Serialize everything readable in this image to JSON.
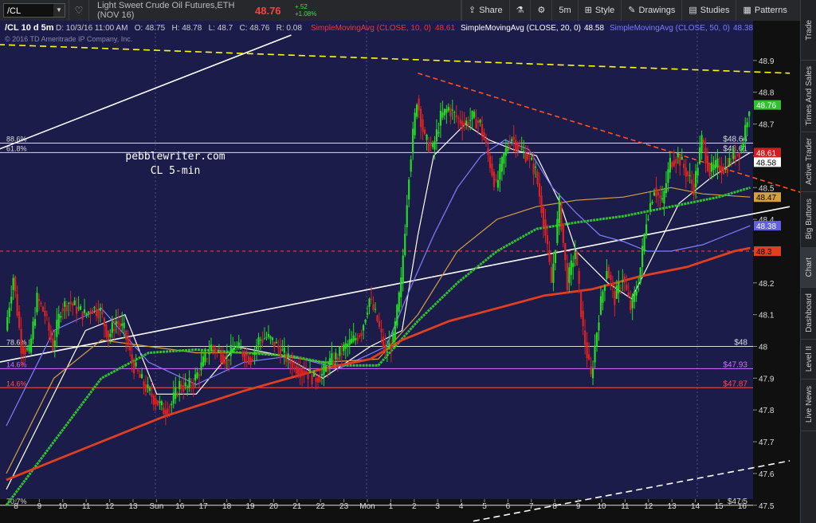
{
  "toolbar": {
    "symbol": "/CL",
    "instrument": "Light Sweet Crude Oil Futures,ETH (NOV 16)",
    "last": "48.76",
    "change": "+.52",
    "change_pct": "+1.08%",
    "buttons": [
      "Share",
      "5m",
      "Style",
      "Drawings",
      "Studies",
      "Patterns"
    ]
  },
  "sidebar": {
    "tabs": [
      "Trade",
      "Times And Sales",
      "Active Trader",
      "Big Buttons",
      "Chart",
      "Dashboard",
      "Level II",
      "Live News"
    ],
    "active": "Chart"
  },
  "legend": {
    "header": "/CL 10 d 5m",
    "ohlc": "D: 10/3/16 11:00 AM   O: 48.75   H: 48.78   L: 48.7   C: 48.76   R: 0.08",
    "sma10_label": "SimpleMovingAvg (CLOSE, 10, 0)",
    "sma10_value": "48.61",
    "sma20_label": "SimpleMovingAvg (CLOSE, 20, 0)",
    "sma20_value": "48.58",
    "sma50_label": "SimpleMovingAvg (CLOSE, 50, 0)",
    "sma50_value": "48.38",
    "copyright": "© 2016 TD Ameritrade IP Company, Inc."
  },
  "chart_data": {
    "type": "candlestick",
    "title": "pebblewriter.com",
    "subtitle": "CL 5-min",
    "ylim": [
      47.45,
      49.0
    ],
    "y_ticks": [
      "48.9",
      "48.8",
      "48.7",
      "48.6",
      "48.5",
      "48.4",
      "48.3",
      "48.2",
      "48.1",
      "48",
      "47.9",
      "47.8",
      "47.7",
      "47.6",
      "47.5"
    ],
    "x_ticks": [
      "8",
      "9",
      "10",
      "11",
      "12",
      "13",
      "Sun",
      "16",
      "17",
      "18",
      "19",
      "20",
      "21",
      "22",
      "23",
      "Mon",
      "1",
      "2",
      "3",
      "4",
      "5",
      "6",
      "7",
      "8",
      "9",
      "10",
      "11",
      "12",
      "13",
      "14",
      "15",
      "16"
    ],
    "price_path": [
      [
        0,
        48.05
      ],
      [
        1,
        48.22
      ],
      [
        2,
        48.0
      ],
      [
        3,
        47.98
      ],
      [
        4,
        48.15
      ],
      [
        5,
        48.1
      ],
      [
        6,
        48.0
      ],
      [
        7,
        48.12
      ],
      [
        8,
        48.14
      ],
      [
        9,
        48.12
      ],
      [
        10,
        48.1
      ],
      [
        11,
        48.12
      ],
      [
        12,
        48.11
      ],
      [
        13,
        48.03
      ],
      [
        14,
        48.08
      ],
      [
        15,
        48.05
      ],
      [
        16,
        47.95
      ],
      [
        17,
        47.9
      ],
      [
        18,
        47.86
      ],
      [
        19,
        47.83
      ],
      [
        20,
        47.8
      ],
      [
        21,
        47.82
      ],
      [
        22,
        47.88
      ],
      [
        23,
        47.87
      ],
      [
        24,
        47.9
      ],
      [
        25,
        47.95
      ],
      [
        26,
        48.0
      ],
      [
        27,
        47.98
      ],
      [
        28,
        47.96
      ],
      [
        29,
        48.0
      ],
      [
        30,
        47.98
      ],
      [
        31,
        47.96
      ],
      [
        32,
        48.02
      ],
      [
        33,
        48.03
      ],
      [
        34,
        48.01
      ],
      [
        35,
        47.98
      ],
      [
        36,
        47.95
      ],
      [
        37,
        47.93
      ],
      [
        38,
        47.92
      ],
      [
        39,
        47.9
      ],
      [
        40,
        47.91
      ],
      [
        41,
        47.95
      ],
      [
        42,
        47.97
      ],
      [
        43,
        48.0
      ],
      [
        44,
        48.02
      ],
      [
        45,
        48.05
      ],
      [
        46,
        48.15
      ],
      [
        47,
        48.08
      ],
      [
        48,
        47.98
      ],
      [
        49,
        48.02
      ],
      [
        50,
        48.2
      ],
      [
        51,
        48.55
      ],
      [
        52,
        48.78
      ],
      [
        53,
        48.65
      ],
      [
        54,
        48.62
      ],
      [
        55,
        48.72
      ],
      [
        56,
        48.75
      ],
      [
        57,
        48.72
      ],
      [
        58,
        48.7
      ],
      [
        59,
        48.72
      ],
      [
        60,
        48.7
      ],
      [
        61,
        48.6
      ],
      [
        62,
        48.5
      ],
      [
        63,
        48.6
      ],
      [
        64,
        48.66
      ],
      [
        65,
        48.62
      ],
      [
        66,
        48.6
      ],
      [
        67,
        48.55
      ],
      [
        68,
        48.4
      ],
      [
        69,
        48.2
      ],
      [
        70,
        48.45
      ],
      [
        71,
        48.2
      ],
      [
        72,
        48.3
      ],
      [
        73,
        48.05
      ],
      [
        74,
        47.9
      ],
      [
        75,
        48.1
      ],
      [
        76,
        48.25
      ],
      [
        77,
        48.15
      ],
      [
        78,
        48.22
      ],
      [
        79,
        48.12
      ],
      [
        80,
        48.2
      ],
      [
        81,
        48.4
      ],
      [
        82,
        48.5
      ],
      [
        83,
        48.45
      ],
      [
        84,
        48.58
      ],
      [
        85,
        48.6
      ],
      [
        86,
        48.55
      ],
      [
        87,
        48.5
      ],
      [
        88,
        48.65
      ],
      [
        89,
        48.55
      ],
      [
        90,
        48.57
      ],
      [
        91,
        48.56
      ],
      [
        92,
        48.6
      ],
      [
        93,
        48.62
      ],
      [
        94,
        48.76
      ]
    ],
    "moving_averages": [
      {
        "name": "SMA 10",
        "color": "#ffffff",
        "values": [
          [
            0,
            47.55
          ],
          [
            10,
            48.05
          ],
          [
            15,
            48.1
          ],
          [
            19,
            47.85
          ],
          [
            24,
            47.85
          ],
          [
            29,
            48.0
          ],
          [
            35,
            47.97
          ],
          [
            40,
            47.9
          ],
          [
            46,
            48.0
          ],
          [
            50,
            48.05
          ],
          [
            52,
            48.35
          ],
          [
            54,
            48.6
          ],
          [
            58,
            48.7
          ],
          [
            61,
            48.65
          ],
          [
            64,
            48.62
          ],
          [
            67,
            48.6
          ],
          [
            70,
            48.45
          ],
          [
            72,
            48.3
          ],
          [
            74,
            48.25
          ],
          [
            76,
            48.2
          ],
          [
            79,
            48.15
          ],
          [
            82,
            48.3
          ],
          [
            85,
            48.45
          ],
          [
            89,
            48.53
          ],
          [
            92,
            48.58
          ],
          [
            94,
            48.61
          ]
        ]
      },
      {
        "name": "SMA 20",
        "color": "#8080ff",
        "values": [
          [
            0,
            47.75
          ],
          [
            6,
            48.05
          ],
          [
            12,
            48.12
          ],
          [
            18,
            47.95
          ],
          [
            24,
            47.88
          ],
          [
            30,
            47.95
          ],
          [
            36,
            47.97
          ],
          [
            42,
            47.93
          ],
          [
            48,
            48.0
          ],
          [
            51,
            48.18
          ],
          [
            54,
            48.35
          ],
          [
            57,
            48.5
          ],
          [
            60,
            48.6
          ],
          [
            63,
            48.65
          ],
          [
            66,
            48.62
          ],
          [
            69,
            48.5
          ],
          [
            72,
            48.42
          ],
          [
            75,
            48.35
          ],
          [
            78,
            48.33
          ],
          [
            81,
            48.3
          ],
          [
            84,
            48.3
          ],
          [
            88,
            48.32
          ],
          [
            91,
            48.35
          ],
          [
            94,
            48.38
          ]
        ]
      },
      {
        "name": "SMA 40",
        "color": "#d4a040",
        "values": [
          [
            0,
            47.6
          ],
          [
            6,
            47.9
          ],
          [
            12,
            48.02
          ],
          [
            18,
            48.0
          ],
          [
            24,
            47.98
          ],
          [
            32,
            47.98
          ],
          [
            40,
            47.95
          ],
          [
            47,
            47.96
          ],
          [
            52,
            48.1
          ],
          [
            57,
            48.3
          ],
          [
            62,
            48.4
          ],
          [
            67,
            48.44
          ],
          [
            72,
            48.46
          ],
          [
            78,
            48.47
          ],
          [
            84,
            48.5
          ],
          [
            88,
            48.48
          ],
          [
            94,
            48.47
          ]
        ]
      },
      {
        "name": "SMA 50",
        "color": "#30c030",
        "values": [
          [
            0,
            47.5
          ],
          [
            6,
            47.7
          ],
          [
            12,
            47.9
          ],
          [
            18,
            47.98
          ],
          [
            24,
            47.99
          ],
          [
            30,
            47.98
          ],
          [
            36,
            47.97
          ],
          [
            42,
            47.94
          ],
          [
            47,
            47.94
          ],
          [
            52,
            48.08
          ],
          [
            57,
            48.2
          ],
          [
            62,
            48.3
          ],
          [
            67,
            48.37
          ],
          [
            72,
            48.39
          ],
          [
            78,
            48.41
          ],
          [
            84,
            48.44
          ],
          [
            90,
            48.47
          ],
          [
            94,
            48.5
          ]
        ]
      },
      {
        "name": "SMA 200",
        "color": "#e04020",
        "values": [
          [
            0,
            47.58
          ],
          [
            10,
            47.68
          ],
          [
            20,
            47.78
          ],
          [
            30,
            47.86
          ],
          [
            40,
            47.93
          ],
          [
            46,
            47.96
          ],
          [
            50,
            48.02
          ],
          [
            56,
            48.08
          ],
          [
            62,
            48.12
          ],
          [
            68,
            48.16
          ],
          [
            74,
            48.18
          ],
          [
            80,
            48.22
          ],
          [
            86,
            48.25
          ],
          [
            92,
            48.3
          ],
          [
            94,
            48.31
          ]
        ]
      }
    ],
    "horizontal_levels": [
      {
        "value": 48.64,
        "label": "$48.64",
        "left": "88.6%",
        "color": "#dddddd"
      },
      {
        "value": 48.61,
        "label": "$48.61",
        "left": "61.8%",
        "color": "#dddddd"
      },
      {
        "value": 48.0,
        "label": "$48",
        "left": "78.6%",
        "color": "#dddddd"
      },
      {
        "value": 47.93,
        "label": "$47.93",
        "left": "14.6%",
        "color": "#d070ff"
      },
      {
        "value": 47.87,
        "label": "$47.87",
        "left": "14.6%",
        "color": "#ff5050"
      },
      {
        "value": 47.5,
        "label": "$47.5",
        "left": "70.7%",
        "color": "#dddddd"
      },
      {
        "value": 48.3,
        "label": "",
        "left": "",
        "color": "#ff4040"
      }
    ],
    "trendlines": [
      {
        "color": "#ffffff",
        "dash": "",
        "from": [
          -1,
          48.62
        ],
        "to": [
          36,
          48.98
        ]
      },
      {
        "color": "#ffff00",
        "dash": "8,5",
        "from": [
          -1,
          48.95
        ],
        "to": [
          99,
          48.86
        ]
      },
      {
        "color": "#ff5020",
        "dash": "6,4",
        "from": [
          52,
          48.86
        ],
        "to": [
          101,
          48.48
        ]
      },
      {
        "color": "#ffffff",
        "dash": "",
        "from": [
          -1,
          47.95
        ],
        "to": [
          99,
          48.44
        ]
      },
      {
        "color": "#ffffff",
        "dash": "8,5",
        "from": [
          59,
          47.45
        ],
        "to": [
          99,
          47.64
        ]
      }
    ],
    "price_badges": [
      {
        "value": 48.76,
        "label": "48.76",
        "bg": "#30c030",
        "fg": "#ffffff"
      },
      {
        "value": 48.61,
        "label": "48.61",
        "bg": "#cc2020",
        "fg": "#ffffff"
      },
      {
        "value": 48.58,
        "label": "48.58",
        "bg": "#ffffff",
        "fg": "#000000"
      },
      {
        "value": 48.47,
        "label": "48.47",
        "bg": "#d4a040",
        "fg": "#000000"
      },
      {
        "value": 48.38,
        "label": "48.38",
        "bg": "#6060e0",
        "fg": "#ffffff"
      },
      {
        "value": 48.3,
        "label": "48.3",
        "bg": "#e04020",
        "fg": "#000000"
      }
    ]
  }
}
